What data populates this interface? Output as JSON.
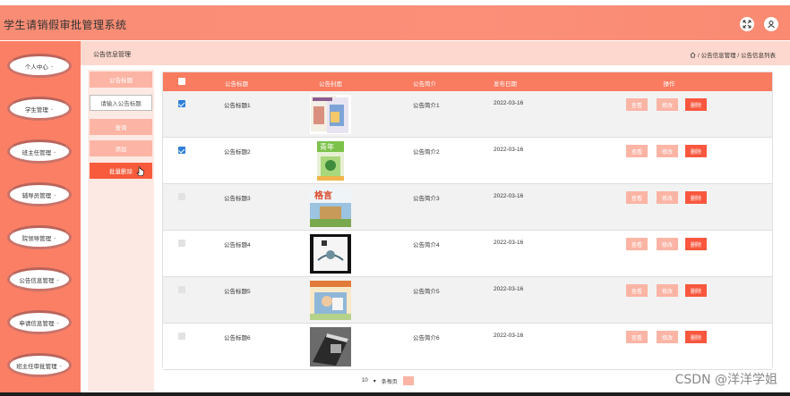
{
  "app": {
    "title": "学生请销假审批管理系统"
  },
  "sidebar": {
    "items": [
      {
        "label": "个人中心"
      },
      {
        "label": "学生管理"
      },
      {
        "label": "班主任管理"
      },
      {
        "label": "辅导员管理"
      },
      {
        "label": "院领导管理"
      },
      {
        "label": "公告信息管理"
      },
      {
        "label": "申请信息管理"
      },
      {
        "label": "班主任审批管理"
      }
    ]
  },
  "breadcrumb": {
    "title": "公告信息管理",
    "path": "/ 公告信息管理 / 公告信息列表"
  },
  "search": {
    "field_label": "公告标题",
    "placeholder": "请输入公告标题",
    "search_label": "查询",
    "add_label": "添加",
    "batch_delete_label": "批量删除"
  },
  "table": {
    "columns": [
      "公告标题",
      "公告封面",
      "公告简介",
      "发布日期",
      "操作"
    ],
    "rows": [
      {
        "checked": true,
        "title": "公告标题1",
        "summary": "公告简介1",
        "date": "2022-03-16"
      },
      {
        "checked": true,
        "title": "公告标题2",
        "summary": "公告简介2",
        "date": "2022-03-16"
      },
      {
        "checked": false,
        "title": "公告标题3",
        "summary": "公告简介3",
        "date": "2022-03-16"
      },
      {
        "checked": false,
        "title": "公告标题4",
        "summary": "公告简介4",
        "date": "2022-03-16"
      },
      {
        "checked": false,
        "title": "公告标题5",
        "summary": "公告简介5",
        "date": "2022-03-16"
      },
      {
        "checked": false,
        "title": "公告标题6",
        "summary": "公告简介6",
        "date": "2022-03-16"
      }
    ],
    "actions": {
      "view": "查看",
      "edit": "修改",
      "delete": "删除"
    },
    "cover_text": {
      "row2": "青年",
      "row3": "格言"
    }
  },
  "pagination": {
    "page_size": "10",
    "page_size_label": "条每页"
  },
  "watermark": "CSDN @洋洋学姐",
  "icons": [
    "expand-icon",
    "user-icon",
    "home-icon",
    "pointer-cursor-icon"
  ],
  "colors": {
    "accent": "#f97b60",
    "danger": "#f9573e",
    "light": "#fcb4a5",
    "sidebar": "#fb7f65"
  }
}
